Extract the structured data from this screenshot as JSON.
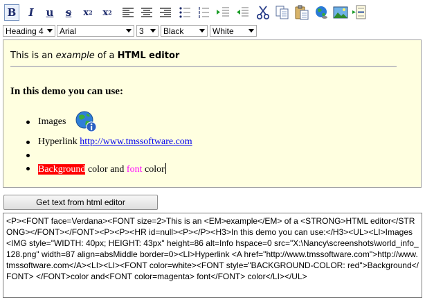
{
  "toolbar": {
    "bold": "B",
    "italic": "I",
    "underline": "u",
    "strike": "s",
    "subscript": "x",
    "sub_mark": "2",
    "superscript": "x",
    "sup_mark": "2"
  },
  "format_bar": {
    "heading": "Heading 4",
    "font": "Arial",
    "size": "3",
    "font_color": "Black",
    "bg_color": "White"
  },
  "editor": {
    "line1": {
      "pre": "This is an ",
      "em": "example",
      "mid": " of a ",
      "strong": "HTML editor"
    },
    "heading": "In this demo you can use:",
    "items": {
      "images": "Images",
      "hyperlink_pre": "Hyperlink ",
      "hyperlink_url": "http://www.tmssoftware.com",
      "background": "Background",
      "mid": " color and ",
      "font": "font",
      "end": " color"
    }
  },
  "button": {
    "label": "Get text from html editor"
  },
  "output": {
    "html": "<P><FONT face=Verdana><FONT size=2>This is an <EM>example</EM> of a <STRONG>HTML editor</STRONG></FONT></FONT><P><P><HR id=null><P></P><H3>In this demo you can use:</H3><UL><LI>Images <IMG style=\"WIDTH: 40px; HEIGHT: 43px\" height=86 alt=Info hspace=0 src=\"X:\\Nancy\\screenshots\\world_info_128.png\" width=87 align=absMiddle border=0><LI>Hyperlink <A href=\"http://www.tmssoftware.com\">http://www.tmssoftware.com</A><LI><LI><FONT color=white><FONT style=\"BACKGROUND-COLOR: red\">Background</FONT> </FONT>color and<FONT color=magenta> font</FONT> color</LI></UL>"
  },
  "colors": {
    "editor_bg": "#ffffe0",
    "highlight_bg": "#ff0000",
    "magenta": "#ff00ff",
    "link": "#0000ee"
  }
}
